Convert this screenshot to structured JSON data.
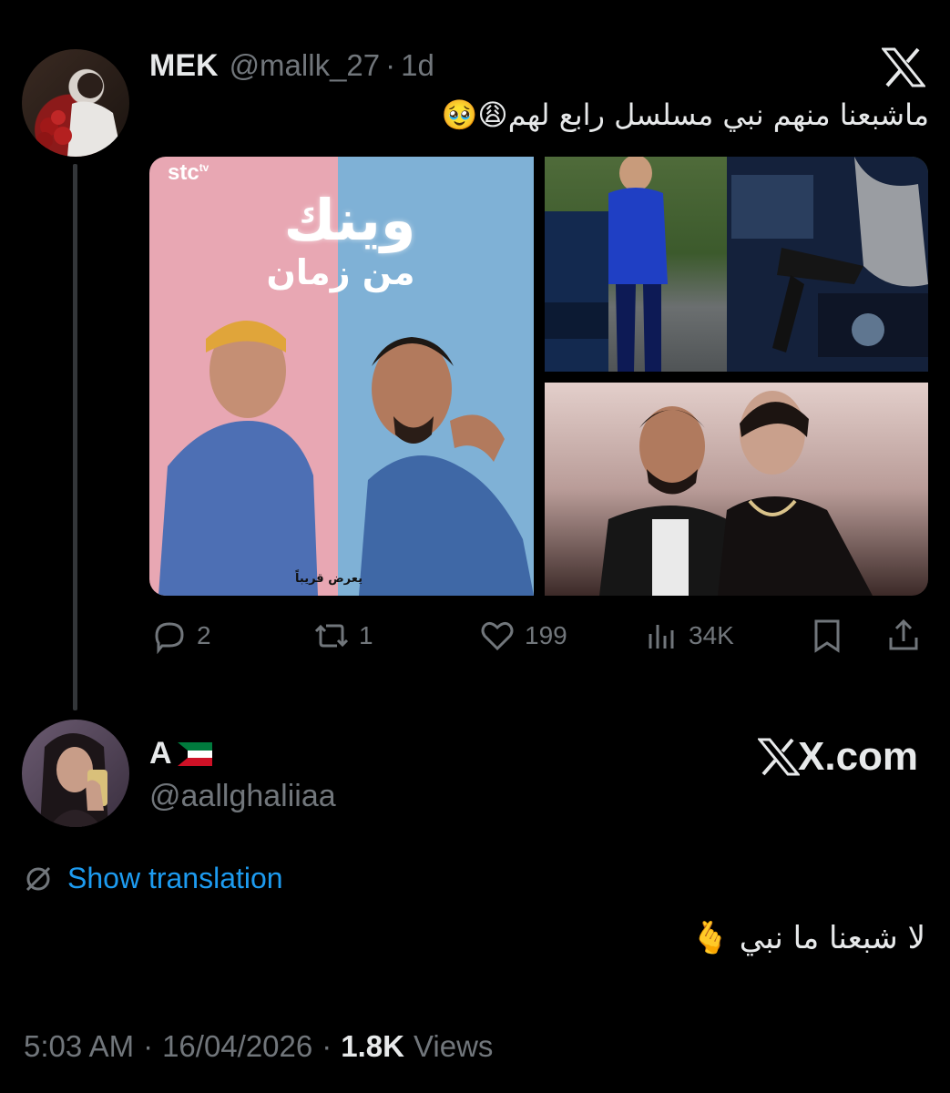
{
  "reply_to_tweet": {
    "author_name": "MEK",
    "handle": "@mallk_27",
    "separator": "·",
    "age": "1d",
    "text": "ماشبعنا منهم نبي مسلسل رابع لهم😩🥹",
    "poster": {
      "brand": "stc",
      "brand_sup": "tv",
      "title_line1": "وينك",
      "title_line2": "من زمان",
      "coming_soon": "يعرض قريباً"
    },
    "actions": {
      "replies": "2",
      "reposts": "1",
      "likes": "199",
      "views": "34K"
    }
  },
  "main_tweet": {
    "author_name": "A",
    "flag": "kuwait-flag",
    "handle": "@aallghaliiaa",
    "watermark": "X.com",
    "show_translation": "Show translation",
    "text": "لا شبعنا ما نبي 🫰",
    "time": "5:03 AM",
    "separator": "·",
    "date": "16/04/2026",
    "views_count": "1.8K",
    "views_label": "Views"
  },
  "colors": {
    "background": "#000000",
    "text": "#e7e9ea",
    "muted": "#71767b",
    "link": "#1d9bf0"
  }
}
